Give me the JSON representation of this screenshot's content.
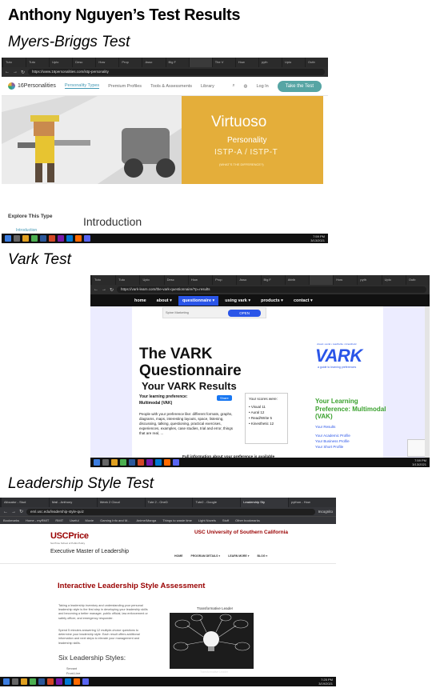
{
  "page": {
    "title": "Anthony Nguyen’s Test Results",
    "sections": {
      "mbti": "Myers-Briggs Test",
      "vark": "Vark Test",
      "leadership": "Leadership Style Test"
    }
  },
  "mbti": {
    "tabs": [
      "Tuto",
      "Tuto",
      "Uplo",
      "Desc",
      "How",
      "Prop",
      "Asso",
      "Big F",
      "",
      "The V",
      "How",
      "pyth",
      "Uplo",
      "Outb"
    ],
    "url": "https://www.16personalities.com/istp-personality",
    "logo": "16Personalities",
    "nav": [
      "Personality Types",
      "Premium Profiles",
      "Tools & Assessments",
      "Library"
    ],
    "login": "Log In",
    "cta": "Take the Test",
    "type_name": "Virtuoso",
    "personality": "Personality",
    "code": "ISTP-A / ISTP-T",
    "what_is_difference": "(WHAT’S THE DIFFERENCE?)",
    "explore": "Explore This Type",
    "intro_link": "Introduction",
    "intro_heading": "Introduction",
    "clock": "7:59 PM",
    "date": "3/13/2021"
  },
  "vark": {
    "tabs": [
      "Tuto",
      "Tuto",
      "Uplo",
      "Desc",
      "How",
      "Prop",
      "Asso",
      "Big F",
      "Attrib",
      "",
      "How",
      "pyth",
      "Uplo",
      "Outb"
    ],
    "url": "https://vark-learn.com/the-vark-questionnaire/?p=results",
    "nav": [
      "home",
      "about ▾",
      "questionnaire ▾",
      "using vark ▾",
      "products ▾",
      "contact ▾"
    ],
    "ad_label": "Spine Marketing",
    "ad_button": "OPEN",
    "heading": "The VARK Questionnaire",
    "results_heading": "Your VARK Results",
    "preference_label": "Your learning preference:",
    "preference_value": "Multimodal (VAK)",
    "share": "Share",
    "description": "People with your preference like: different formats, graphs, diagrams, maps, interesting layouts, space, listening, discussing, talking, questioning, practical exercises, experiences, examples, case studies, trial and error, things that are real, ...",
    "scores_title": "Your scores were:",
    "scores": [
      "Visual 11",
      "Aural 12",
      "Read/Write 5",
      "Kinesthetic 12"
    ],
    "logo_tag": "visual • aural • read/write • kinesthetic",
    "logo": "VARK",
    "logo_sub": "a guide to learning preferences",
    "your_preference": "Your Learning Preference: Multimodal (VAK)",
    "links": [
      "Your Results",
      "Your Academic Profile",
      "Your Business Profile",
      "Your Short Profile"
    ],
    "full_info": "Full information about your preference is available",
    "clock": "7:59 PM",
    "date": "3/13/2021"
  },
  "leadership": {
    "tabs": [
      "Allocator - Stud",
      "Mail - Anthony",
      "Week 2 Cloud",
      "Tute 2 - OneD",
      "Tute2 - Google",
      "Leadership Sty",
      "python - How"
    ],
    "url": "eml.usc.edu/leadership-style-quiz",
    "incognito": "Incognito",
    "bookmarks": [
      "Bookmarks",
      "Home - myRMIT",
      "RMIT",
      "Useful",
      "Movie",
      "Gaming Info and M...",
      "Anime/Manga",
      "Things to waste time",
      "Light Novels",
      "Stuff",
      "Other bookmarks"
    ],
    "school": "USCPrice",
    "school_sub": "Sol Price School of Public Policy",
    "program": "Executive Master of Leadership",
    "university": "USC University of Southern California",
    "nav": [
      "HOME",
      "PROGRAM DETAILS ▾",
      "LEARN MORE ▾",
      "BLOG ▾"
    ],
    "assessment_title": "Interactive Leadership Style Assessment",
    "intro": "Taking a leadership inventory and understanding your personal leadership style is the first step in developing your leadership skills and becoming a better manager, public official, law enforcement or safety officer, and emergency responder.",
    "intro2": "Spend 5 minutes answering 12 multiple-choice questions to determine your leadership style. Each result offers additional information and next steps to elevate your management and leadership skills.",
    "six_styles": "Six Leadership Styles:",
    "styles": [
      "Servant",
      "Front-Line"
    ],
    "image_title": "Transformative Leader",
    "image_caption": "Transformative Leader",
    "clock": "7:25 PM",
    "date": "3/19/2021"
  },
  "colors": {
    "p16_teal": "#56a5a4",
    "p16_gold": "#e4ae3a",
    "vark_blue": "#2a55e8",
    "vark_green": "#3aa12e",
    "usc_cardinal": "#990000"
  }
}
